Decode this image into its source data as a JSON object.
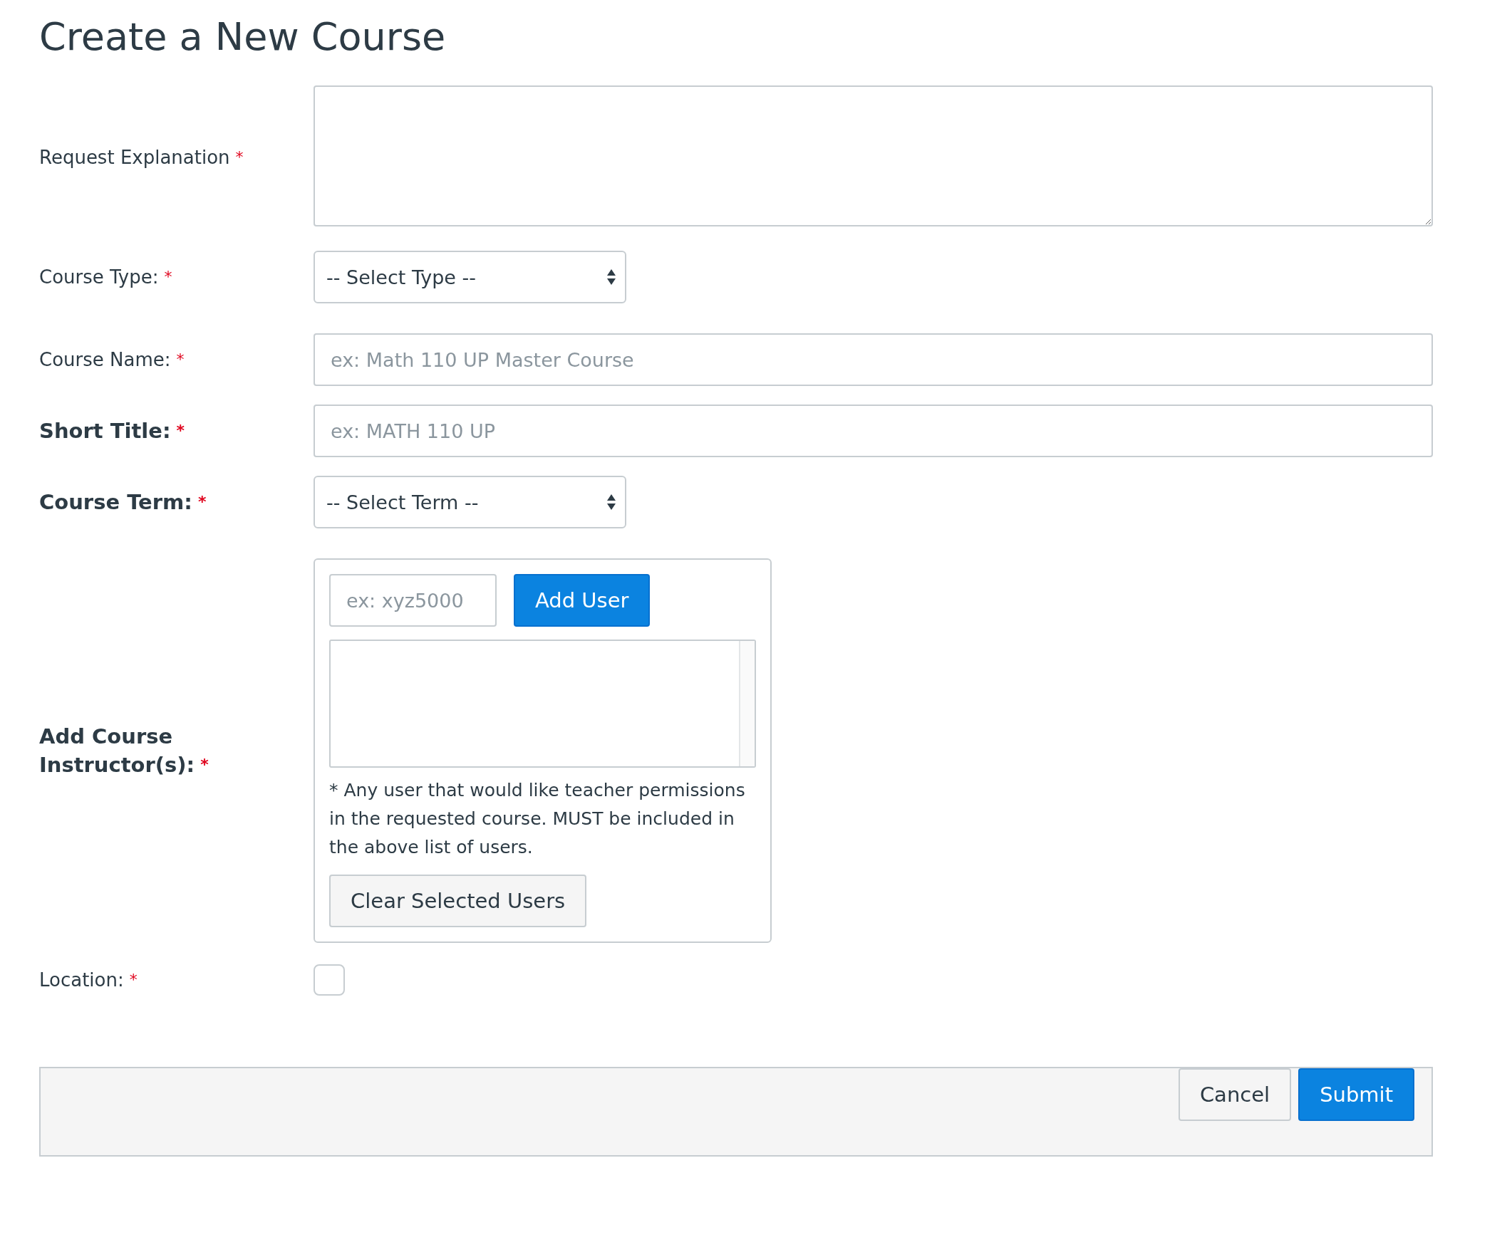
{
  "title": "Create a New Course",
  "fields": [
    {
      "kind": "textarea",
      "label": "Request Explanation",
      "bold": false,
      "required": "*"
    },
    {
      "kind": "select",
      "label": "Course Type:",
      "bold": false,
      "required": "*",
      "value": "-- Select Type --"
    },
    {
      "kind": "input",
      "label": "Course Name:",
      "bold": false,
      "required": "*",
      "placeholder": "ex: Math 110 UP Master Course"
    },
    {
      "kind": "input",
      "label": "Short Title:",
      "bold": true,
      "required": "*",
      "placeholder": "ex: MATH 110 UP"
    },
    {
      "kind": "select",
      "label": "Course Term:",
      "bold": true,
      "required": "*",
      "value": "-- Select Term --"
    },
    {
      "kind": "instructors",
      "label": "Add Course Instructor(s):",
      "bold": true,
      "required": "*",
      "placeholder": "ex: xyz5000",
      "add_button": "Add User",
      "note": "* Any user that would like teacher permissions in the requested course. MUST be included in the above list of users.",
      "clear_button": "Clear Selected Users"
    },
    {
      "kind": "checkbox",
      "label": "Location:",
      "bold": false,
      "required": "*",
      "checked": false
    }
  ],
  "footer": {
    "buttons": [
      {
        "label": "Cancel",
        "primary": false
      },
      {
        "label": "Submit",
        "primary": true
      }
    ]
  }
}
